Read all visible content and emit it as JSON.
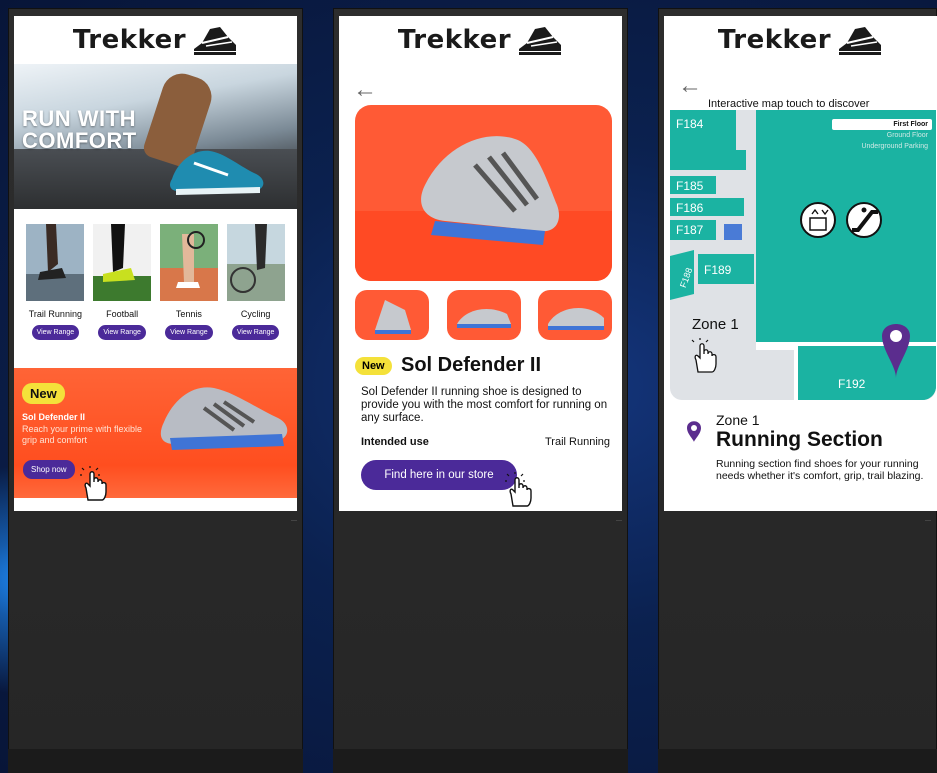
{
  "brand": "Trekker",
  "kiosk1": {
    "hero_title": "RUN WITH COMFORT",
    "categories": [
      {
        "label": "Trail Running",
        "button": "View Range"
      },
      {
        "label": "Football",
        "button": "View Range"
      },
      {
        "label": "Tennis",
        "button": "View Range"
      },
      {
        "label": "Cycling",
        "button": "View Range"
      }
    ],
    "promo": {
      "badge": "New",
      "title": "Sol Defender II",
      "subtitle": "Reach your prime with flexible grip and comfort",
      "button": "Shop now"
    }
  },
  "kiosk2": {
    "badge": "New",
    "name": "Sol Defender II",
    "description": "Sol Defender II running shoe is designed to provide you with the most comfort for running on any surface.",
    "intended_label": "Intended use",
    "intended_value": "Trail Running",
    "button": "Find here in our store"
  },
  "kiosk3": {
    "map_caption": "Interactive map touch to discover",
    "floors": {
      "first": "First Floor",
      "ground": "Ground Floor",
      "underground": "Underground Parking"
    },
    "rooms": {
      "f184": "F184",
      "f185": "F185",
      "f186": "F186",
      "f187": "F187",
      "f188": "F188",
      "f189": "F189",
      "f192": "F192"
    },
    "zone_label": "Zone 1",
    "zone_title": "Zone 1",
    "section": "Running Section",
    "description": "Running section find shoes for your running needs whether it's comfort, grip, trail blazing."
  },
  "colors": {
    "accent": "#4b2a99",
    "teal": "#1bb3a2",
    "orange": "#ff5a35",
    "badge": "#f4e13a"
  }
}
